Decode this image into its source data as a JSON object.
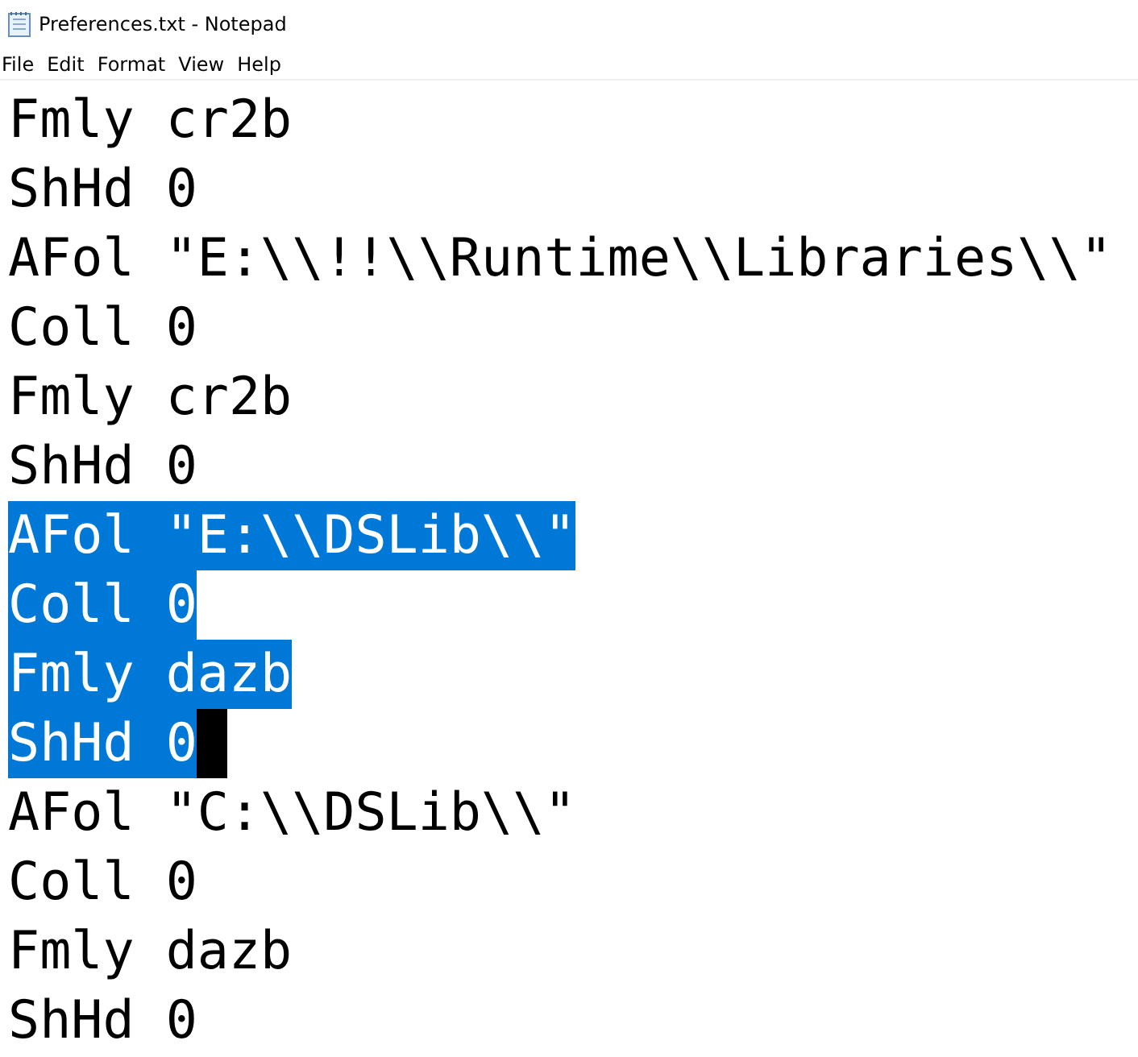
{
  "window": {
    "title": "Preferences.txt - Notepad"
  },
  "menu": [
    {
      "label": "File"
    },
    {
      "label": "Edit"
    },
    {
      "label": "Format"
    },
    {
      "label": "View"
    },
    {
      "label": "Help"
    }
  ],
  "lines": [
    {
      "text": "Fmly cr2b",
      "selected": false,
      "caret": false
    },
    {
      "text": "ShHd 0",
      "selected": false,
      "caret": false
    },
    {
      "text": "AFol \"E:\\\\!!\\\\Runtime\\\\Libraries\\\\\"",
      "selected": false,
      "caret": false
    },
    {
      "text": "Coll 0",
      "selected": false,
      "caret": false
    },
    {
      "text": "Fmly cr2b",
      "selected": false,
      "caret": false
    },
    {
      "text": "ShHd 0",
      "selected": false,
      "caret": false
    },
    {
      "text": "AFol \"E:\\\\DSLib\\\\\"",
      "selected": true,
      "caret": false
    },
    {
      "text": "Coll 0",
      "selected": true,
      "caret": false
    },
    {
      "text": "Fmly dazb",
      "selected": true,
      "caret": false
    },
    {
      "text": "ShHd 0",
      "selected": true,
      "caret": true
    },
    {
      "text": "AFol \"C:\\\\DSLib\\\\\"",
      "selected": false,
      "caret": false
    },
    {
      "text": "Coll 0",
      "selected": false,
      "caret": false
    },
    {
      "text": "Fmly dazb",
      "selected": false,
      "caret": false
    },
    {
      "text": "ShHd 0",
      "selected": false,
      "caret": false
    }
  ]
}
